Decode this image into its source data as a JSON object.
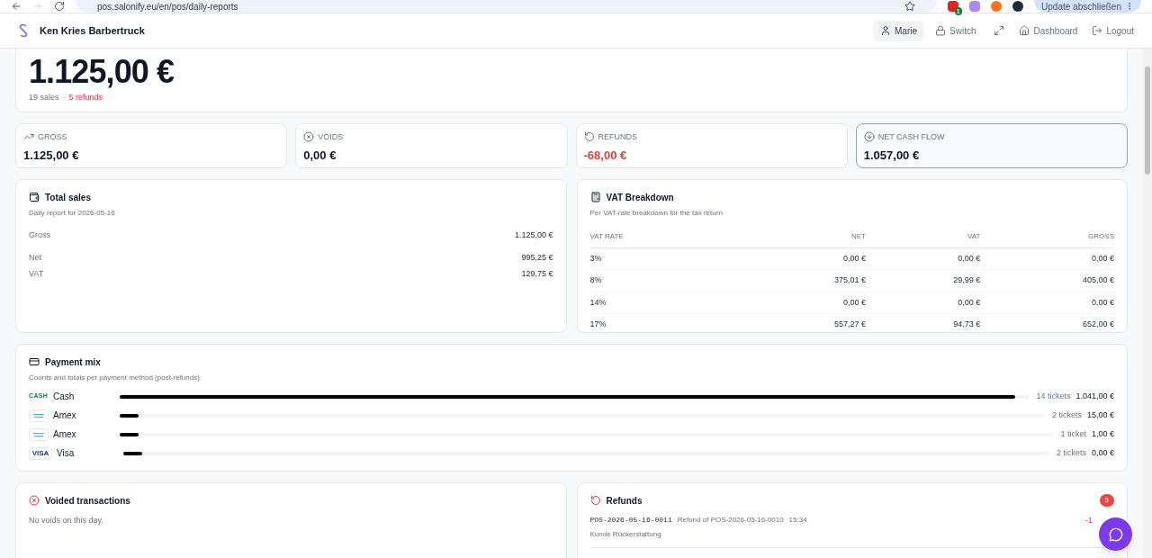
{
  "browser": {
    "url": "pos.salonify.eu/en/pos/daily-reports",
    "extension_badge": "1",
    "update_button": "Update abschließen"
  },
  "header": {
    "title": "Ken Kries Barbertruck",
    "user": "Marie",
    "actions": [
      "Switch",
      "Dashboard",
      "Logout"
    ]
  },
  "summary": {
    "total": "1.125,00 €",
    "sales": "19 sales",
    "separator": "·",
    "refunds": "5 refunds"
  },
  "stats": [
    {
      "kind": "gross",
      "label": "GROSS",
      "value": "1.125,00 €",
      "negative": false,
      "highlighted": false
    },
    {
      "kind": "voids",
      "label": "VOIDS",
      "value": "0,00 €",
      "negative": false,
      "highlighted": false
    },
    {
      "kind": "refunds",
      "label": "REFUNDS",
      "value": "-68,00 €",
      "negative": true,
      "highlighted": false
    },
    {
      "kind": "net",
      "label": "NET CASH FLOW",
      "value": "1.057,00 €",
      "negative": false,
      "highlighted": true
    }
  ],
  "total_sales": {
    "title": "Total sales",
    "subtitle": "Daily report for 2026-05-16",
    "rows": [
      {
        "label": "Gross",
        "value": "1.125,00 €"
      },
      {
        "label": "Net",
        "value": "995,25 €"
      },
      {
        "label": "VAT",
        "value": "129,75 €"
      }
    ]
  },
  "vat_breakdown": {
    "title": "VAT Breakdown",
    "subtitle": "Per VAT-rate breakdown for the tax return",
    "columns": [
      "VAT RATE",
      "NET",
      "VAT",
      "GROSS"
    ],
    "rows": [
      [
        "3%",
        "0,00 €",
        "0,00 €",
        "0,00 €"
      ],
      [
        "8%",
        "375,01 €",
        "29,99 €",
        "405,00 €"
      ],
      [
        "14%",
        "0,00 €",
        "0,00 €",
        "0,00 €"
      ],
      [
        "17%",
        "557,27 €",
        "94,73 €",
        "652,00 €"
      ]
    ]
  },
  "payment_mix": {
    "title": "Payment mix",
    "subtitle": "Counts and totals per payment method (post-refunds)",
    "methods": [
      {
        "kind": "cash",
        "badge": "CASH",
        "name": "Cash",
        "level": 0.985,
        "count": "14 tickets",
        "amount": "1.041,00 €"
      },
      {
        "kind": "amex",
        "name": "Amex",
        "level": 0.02,
        "count": "2 tickets",
        "amount": "15,00 €"
      },
      {
        "kind": "amex",
        "name": "Amex",
        "level": 0.02,
        "count": "1 ticket",
        "amount": "1,00 €"
      },
      {
        "kind": "visa",
        "badge": "VISA",
        "name": "Visa",
        "level": 0.02,
        "count": "2 tickets",
        "amount": "0,00 €"
      }
    ]
  },
  "voided": {
    "title": "Voided transactions",
    "empty": "No voids on this day."
  },
  "refunds": {
    "title": "Refunds",
    "count": "5",
    "items": [
      {
        "id": "POS-2026-05-16-0011",
        "description": "Refund of POS-2026-05-16-0010",
        "time": "15:34",
        "note": "Kunde Rückerstattung",
        "amount": "-1"
      }
    ]
  }
}
